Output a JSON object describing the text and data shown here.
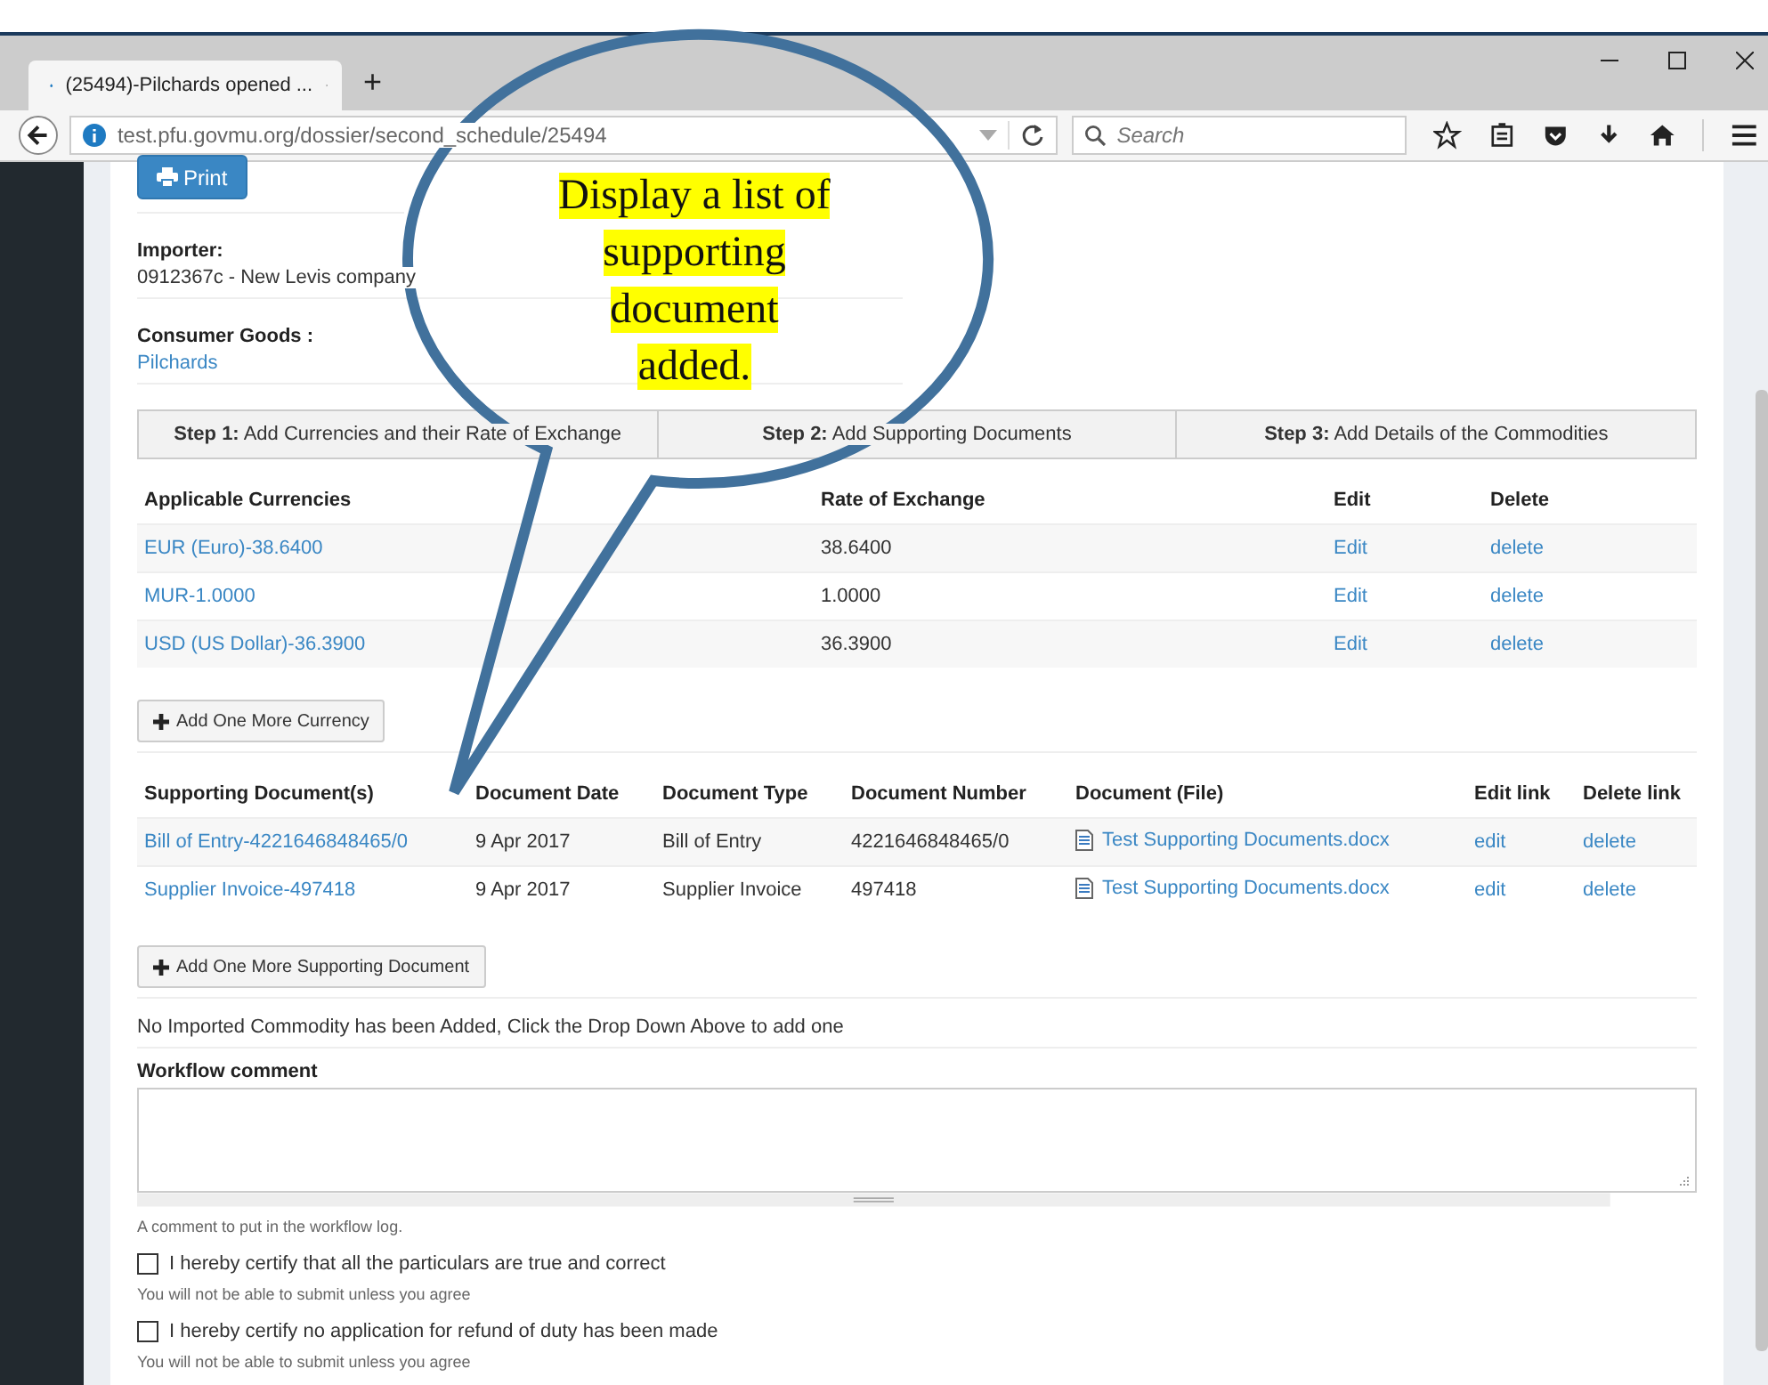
{
  "browser": {
    "tab_title": "(25494)-Pilchards opened ...",
    "new_tab": "+",
    "url": "test.pfu.govmu.org/dossier/second_schedule/25494",
    "search_placeholder": "Search"
  },
  "print_button": "Print",
  "importer": {
    "label": "Importer:",
    "value": "0912367c - New Levis company"
  },
  "consumer_goods": {
    "label": "Consumer Goods :",
    "value": "Pilchards"
  },
  "steps": [
    {
      "number": "Step 1:",
      "label": "Add Currencies and their Rate of Exchange",
      "selected": false
    },
    {
      "number": "Step 2:",
      "label": "Add Supporting Documents",
      "selected": false
    },
    {
      "number": "Step 3:",
      "label": "Add Details of the Commodities",
      "selected": false
    }
  ],
  "currencies": {
    "columns": [
      "Applicable Currencies",
      "Rate of Exchange",
      "Edit",
      "Delete"
    ],
    "rows": [
      {
        "currency": "EUR (Euro)-38.6400",
        "rate": "38.6400",
        "edit": "Edit",
        "delete": "delete"
      },
      {
        "currency": "MUR-1.0000",
        "rate": "1.0000",
        "edit": "Edit",
        "delete": "delete"
      },
      {
        "currency": "USD (US Dollar)-36.3900",
        "rate": "36.3900",
        "edit": "Edit",
        "delete": "delete"
      }
    ]
  },
  "add_currency_button": "Add One More Currency",
  "documents": {
    "columns": [
      "Supporting Document(s)",
      "Document Date",
      "Document Type",
      "Document Number",
      "Document (File)",
      "Edit link",
      "Delete link"
    ],
    "rows": [
      {
        "document": "Bill of Entry-4221646848465/0",
        "date": "9 Apr 2017",
        "type": "Bill of Entry",
        "number": "4221646848465/0",
        "file": "Test Supporting Documents.docx",
        "edit": "edit",
        "delete": "delete"
      },
      {
        "document": "Supplier Invoice-497418",
        "date": "9 Apr 2017",
        "type": "Supplier Invoice",
        "number": "497418",
        "file": "Test Supporting Documents.docx",
        "edit": "edit",
        "delete": "delete"
      }
    ]
  },
  "add_document_button": "Add One More Supporting Document",
  "notice": "No Imported Commodity has been Added, Click the Drop Down Above to add one",
  "workflow": {
    "label": "Workflow comment",
    "hint": "A comment to put in the workflow log."
  },
  "certifications": [
    {
      "label": "I hereby certify that all the particulars are true and correct",
      "checked": false,
      "hint": "You will not be able to submit unless you agree"
    },
    {
      "label": "I hereby certify no application for refund of duty has been made",
      "checked": false,
      "hint": "You will not be able to submit unless you agree"
    }
  ],
  "callout": {
    "lines": [
      "Display a list of",
      "supporting",
      "document",
      "added."
    ]
  }
}
